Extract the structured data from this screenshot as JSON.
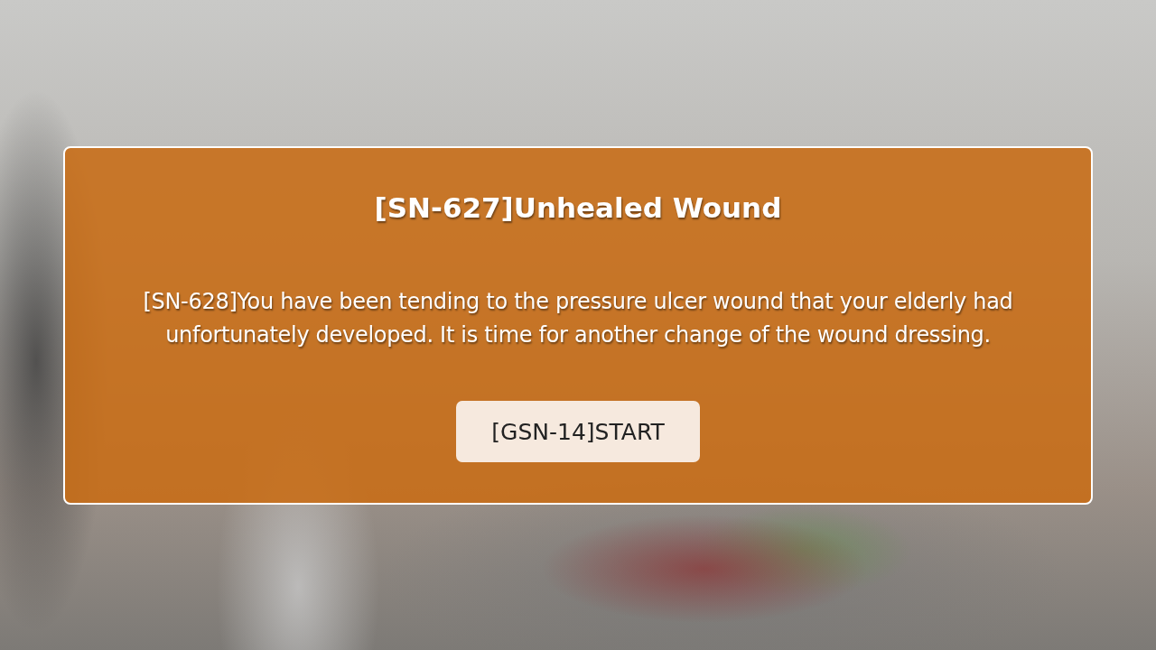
{
  "dialog": {
    "title": "[SN-627]Unhealed Wound",
    "message": "[SN-628]You have been tending to the pressure ulcer wound that your elderly had unfortunately developed.  It is time for another change of the wound dressing.",
    "button": "[GSN-14]START"
  }
}
